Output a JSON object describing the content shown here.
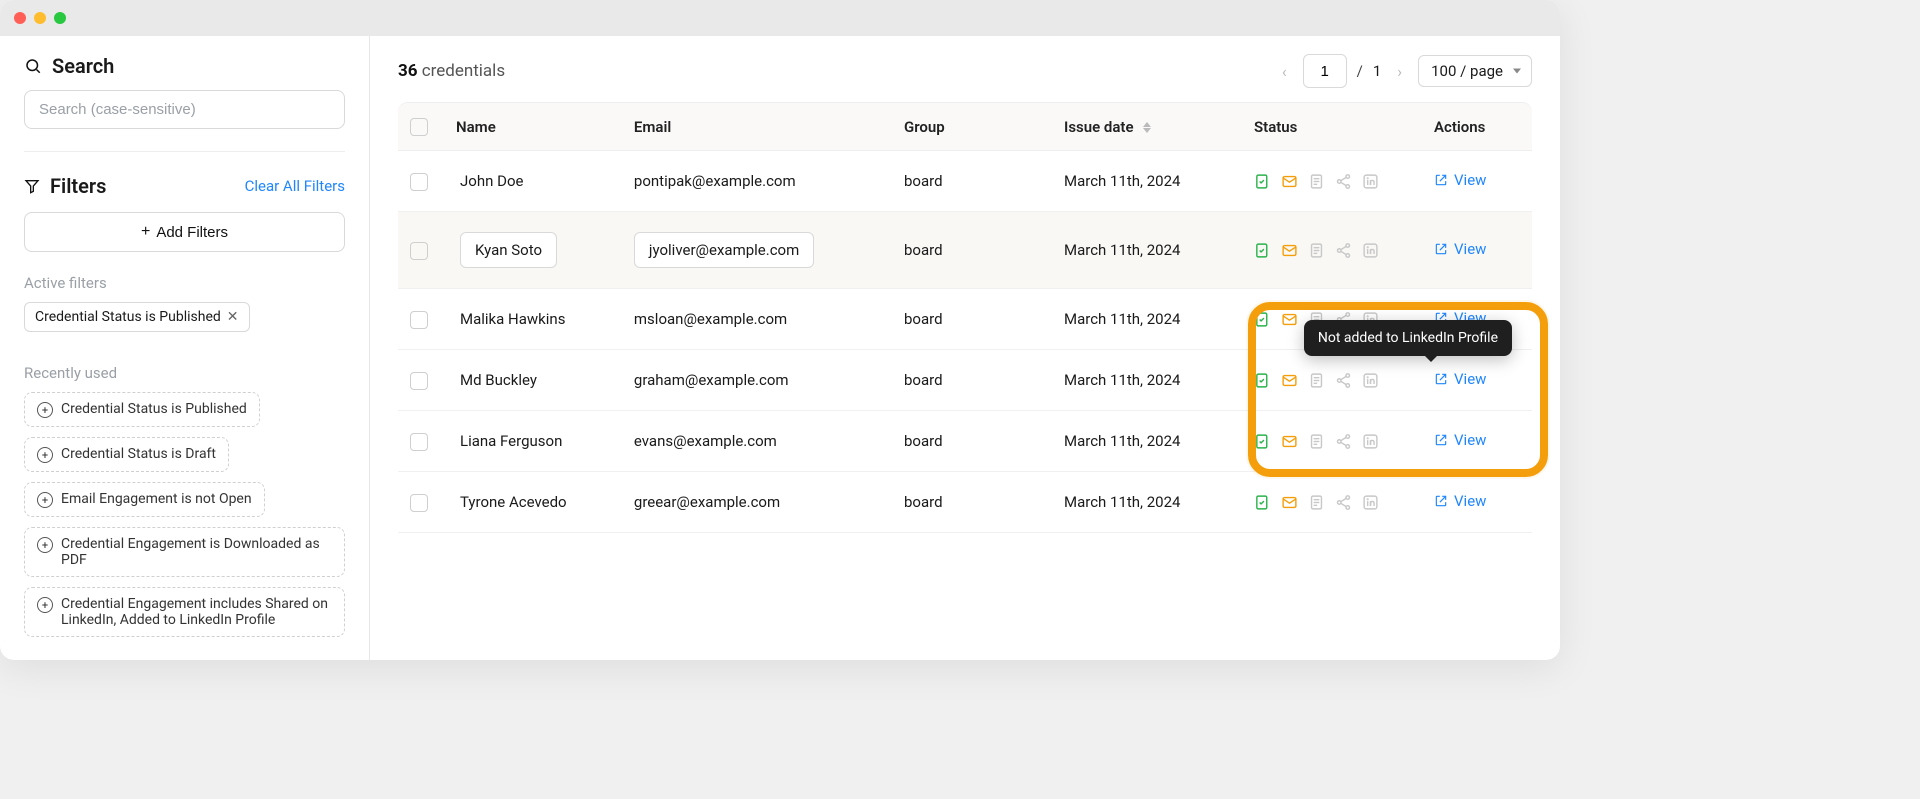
{
  "sidebar": {
    "search_title": "Search",
    "search_placeholder": "Search (case-sensitive)",
    "filters_title": "Filters",
    "clear_all": "Clear All Filters",
    "add_filters": "Add Filters",
    "active_filters_label": "Active filters",
    "active_filter_chip": "Credential Status is Published",
    "recent_label": "Recently used",
    "suggestions": [
      "Credential Status is Published",
      "Credential Status is Draft",
      "Email Engagement is not Open",
      "Credential Engagement is Downloaded as PDF",
      "Credential Engagement includes Shared on LinkedIn, Added to LinkedIn Profile"
    ]
  },
  "main": {
    "count_number": "36",
    "count_label": "credentials",
    "page_current": "1",
    "page_total": "1",
    "per_page": "100 / page",
    "columns": {
      "name": "Name",
      "email": "Email",
      "group": "Group",
      "issue_date": "Issue date",
      "status": "Status",
      "actions": "Actions"
    },
    "view_label": "View",
    "tooltip": "Not added to LinkedIn Profile",
    "rows": [
      {
        "name": "John Doe",
        "email": "pontipak@example.com",
        "group": "board",
        "date": "March 11th, 2024",
        "editing": false
      },
      {
        "name": "Kyan Soto",
        "email": "jyoliver@example.com",
        "group": "board",
        "date": "March 11th, 2024",
        "editing": true
      },
      {
        "name": "Malika Hawkins",
        "email": "msloan@example.com",
        "group": "board",
        "date": "March 11th, 2024",
        "editing": false
      },
      {
        "name": "Md Buckley",
        "email": "graham@example.com",
        "group": "board",
        "date": "March 11th, 2024",
        "editing": false
      },
      {
        "name": "Liana Ferguson",
        "email": "evans@example.com",
        "group": "board",
        "date": "March 11th, 2024",
        "editing": false
      },
      {
        "name": "Tyrone Acevedo",
        "email": "greear@example.com",
        "group": "board",
        "date": "March 11th, 2024",
        "editing": false
      }
    ],
    "status_icons": {
      "published": "published-icon",
      "email": "email-icon",
      "pdf": "pdf-icon",
      "share": "share-icon",
      "linkedin": "linkedin-icon"
    },
    "colors": {
      "green": "#2bb24c",
      "orange": "#f59e0b",
      "grey": "#c8c8c8",
      "link": "#1f86ff"
    }
  }
}
